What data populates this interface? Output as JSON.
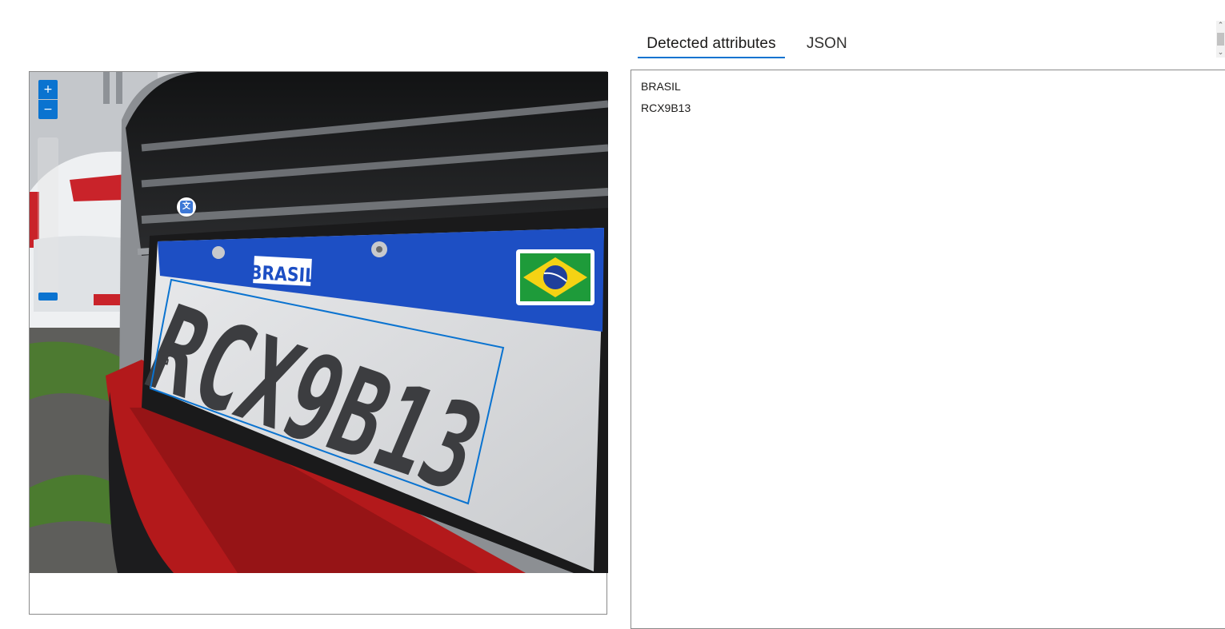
{
  "tabs": {
    "detected": "Detected attributes",
    "json": "JSON"
  },
  "viewer": {
    "zoom_in": "+",
    "zoom_out": "−",
    "zoom_level": 0.05,
    "plate_country": "BRASIL",
    "plate_number": "RCX9B13",
    "plate_side": "BR",
    "translate_icon": "translate-icon"
  },
  "results": {
    "lines": [
      "BRASIL",
      "RCX9B13"
    ]
  },
  "colors": {
    "accent": "#0a73d0",
    "plate_blue": "#1d4fc4",
    "bumper_red": "#b3191b"
  }
}
